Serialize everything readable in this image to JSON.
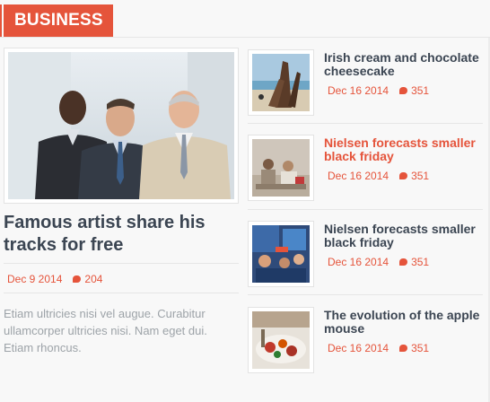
{
  "section": {
    "title": "BUSINESS"
  },
  "feature": {
    "title": "Famous artist share his tracks for free",
    "date": "Dec 9 2014",
    "comments": "204",
    "excerpt": "Etiam ultricies nisi vel augue. Curabitur ullamcorper ultricies nisi. Nam eget dui. Etiam rhoncus.",
    "image": "business-men-photo"
  },
  "items": [
    {
      "title": "Irish cream and chocolate cheesecake",
      "date": "Dec 16 2014",
      "comments": "351",
      "image": "beach-wreck-photo",
      "accent": false
    },
    {
      "title": "Nielsen forecasts smaller black friday",
      "date": "Dec 16 2014",
      "comments": "351",
      "image": "street-people-photo",
      "accent": true
    },
    {
      "title": "Nielsen forecasts smaller black friday",
      "date": "Dec 16 2014",
      "comments": "351",
      "image": "crowd-fans-photo",
      "accent": false
    },
    {
      "title": "The evolution of the apple mouse",
      "date": "Dec 16 2014",
      "comments": "351",
      "image": "food-plate-photo",
      "accent": false
    }
  ],
  "colors": {
    "accent": "#e5543b",
    "title": "#3b4552",
    "excerpt": "#9da3a8"
  }
}
